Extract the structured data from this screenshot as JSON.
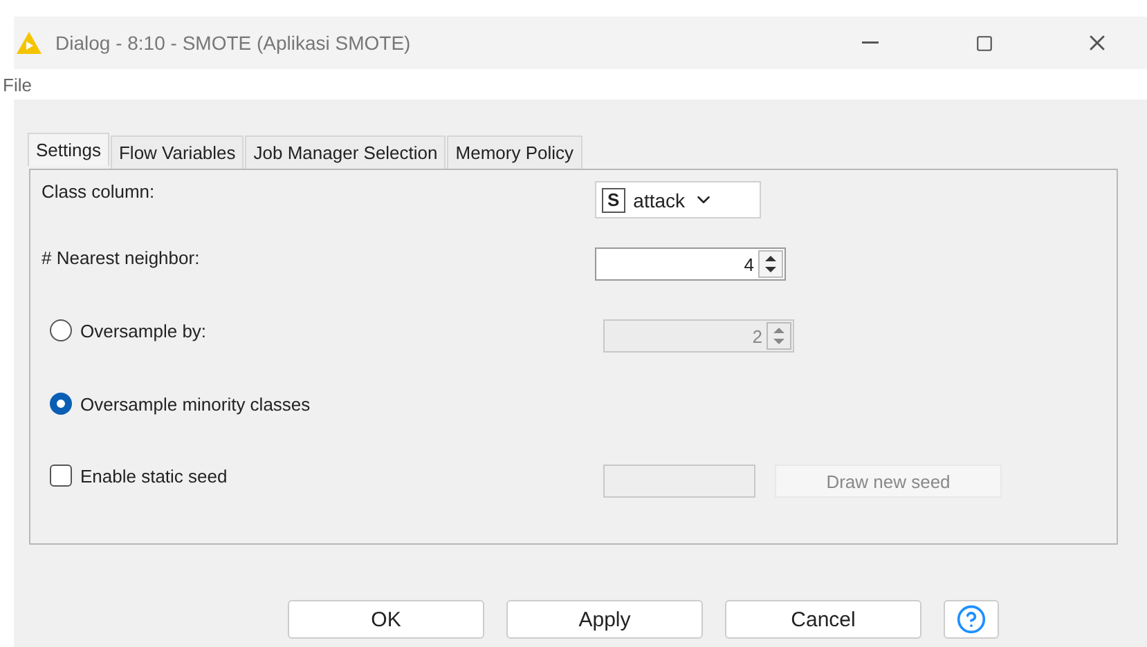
{
  "window": {
    "title": "Dialog - 8:10 - SMOTE (Aplikasi SMOTE)"
  },
  "menu": [
    "File"
  ],
  "tabs": [
    {
      "label": "Settings",
      "selected": true
    },
    {
      "label": "Flow Variables",
      "selected": false
    },
    {
      "label": "Job Manager Selection",
      "selected": false
    },
    {
      "label": "Memory Policy",
      "selected": false
    }
  ],
  "settings": {
    "class_column": {
      "label": "Class column:",
      "type_badge": "S",
      "value": "attack"
    },
    "nearest_neighbor": {
      "label": "# Nearest neighbor:",
      "value": "4",
      "disabled": false
    },
    "options": [
      {
        "label": "Oversample by:",
        "selected": false,
        "value": "2",
        "disabled": true
      },
      {
        "label": "Oversample minority classes",
        "selected": true
      }
    ],
    "static_seed": {
      "label": "Enable static seed",
      "checked": false,
      "button": "Draw new seed",
      "disabled": true
    }
  },
  "buttons": [
    "OK",
    "Apply",
    "Cancel"
  ]
}
